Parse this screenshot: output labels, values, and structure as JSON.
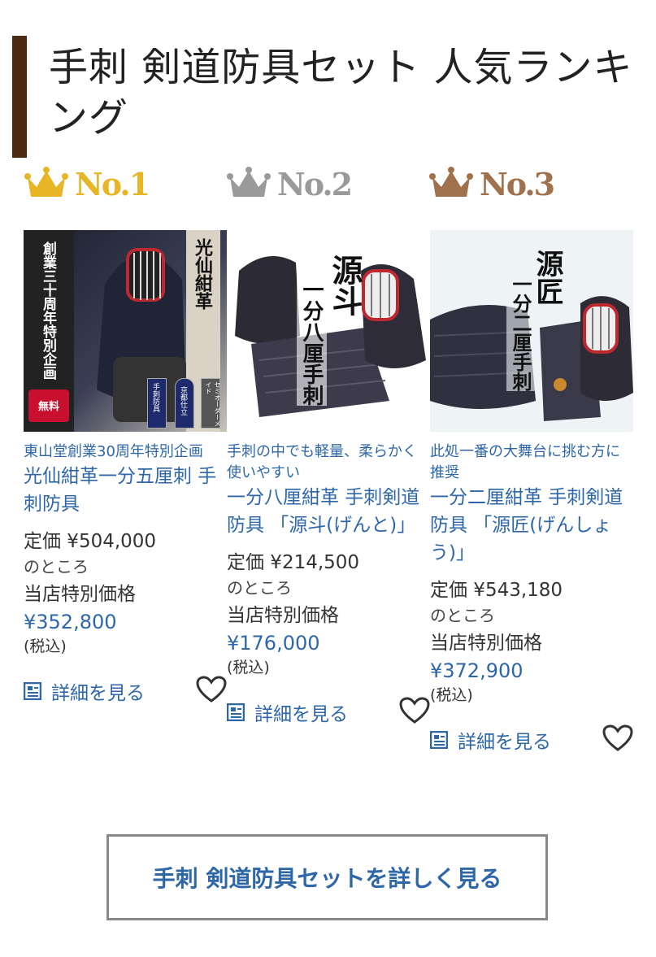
{
  "page": {
    "title": "手刺 剣道防具セット 人気ランキング",
    "cta_label": "手刺 剣道防具セットを詳しく見る"
  },
  "colors": {
    "accent_bar": "#4a2c12",
    "link": "#2e67a8",
    "gold": "#e8b526",
    "silver": "#9a9a9a",
    "bronze": "#a0714d"
  },
  "ranks": [
    {
      "label": "No.1",
      "crown_icon": "gold-crown-icon"
    },
    {
      "label": "No.2",
      "crown_icon": "silver-crown-icon"
    },
    {
      "label": "No.3",
      "crown_icon": "bronze-crown-icon"
    }
  ],
  "products": [
    {
      "image_text": [
        "創業三十周年特別企画",
        "光仙紺革",
        "無料",
        "京都仕立",
        "手刺防具",
        "セミオーダーメイド"
      ],
      "catch": "東山堂創業30周年特別企画",
      "name": "光仙紺革一分五厘刺 手刺防具",
      "list_price": "定価 ¥504,000",
      "notokoro": "のところ",
      "special_label": "当店特別価格",
      "sale_price": "¥352,800",
      "tax": "(税込)",
      "detail_label": "詳細を見る"
    },
    {
      "image_text": [
        "源斗",
        "一分八厘手刺"
      ],
      "catch": "手刺の中でも軽量、柔らかく使いやすい",
      "name": "一分八厘紺革 手刺剣道防具 「源斗(げんと)」",
      "list_price": "定価 ¥214,500",
      "notokoro": "のところ",
      "special_label": "当店特別価格",
      "sale_price": "¥176,000",
      "tax": "(税込)",
      "detail_label": "詳細を見る"
    },
    {
      "image_text": [
        "源匠",
        "一分二厘手刺"
      ],
      "catch": "此処一番の大舞台に挑む方に推奨",
      "name": "一分二厘紺革 手刺剣道防具 「源匠(げんしょう)」",
      "list_price": "定価 ¥543,180",
      "notokoro": "のところ",
      "special_label": "当店特別価格",
      "sale_price": "¥372,900",
      "tax": "(税込)",
      "detail_label": "詳細を見る"
    }
  ]
}
